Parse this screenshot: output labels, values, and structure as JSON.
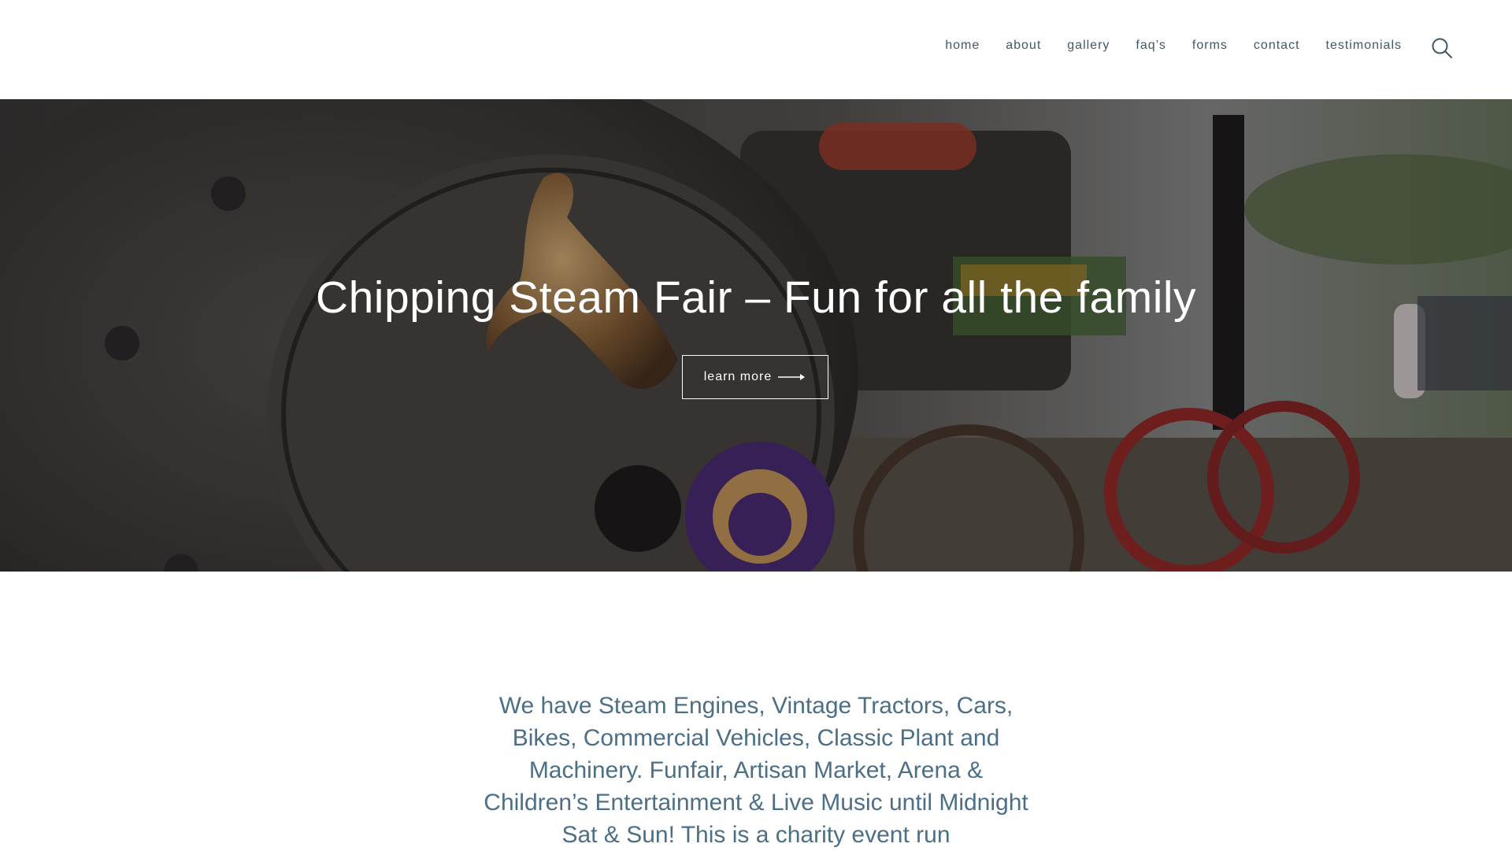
{
  "nav": {
    "items": [
      {
        "label": "home"
      },
      {
        "label": "about"
      },
      {
        "label": "gallery"
      },
      {
        "label": "faq’s"
      },
      {
        "label": "forms"
      },
      {
        "label": "contact"
      },
      {
        "label": "testimonials"
      }
    ],
    "search_icon": "search-icon"
  },
  "hero": {
    "title": "Chipping Steam Fair – Fun for all the family",
    "button_label": "learn more",
    "button_icon": "arrow-right-icon"
  },
  "intro": {
    "text": "We have Steam Engines, Vintage Tractors, Cars, Bikes, Commercial Vehicles, Classic Plant and Machinery. Funfair, Artisan Market, Arena & Children’s Entertainment & Live Music until Midnight Sat & Sun! This is a charity event run"
  },
  "colors": {
    "nav_text": "#3f5866",
    "intro_text": "#4b6f86",
    "hero_text": "#ffffff"
  }
}
